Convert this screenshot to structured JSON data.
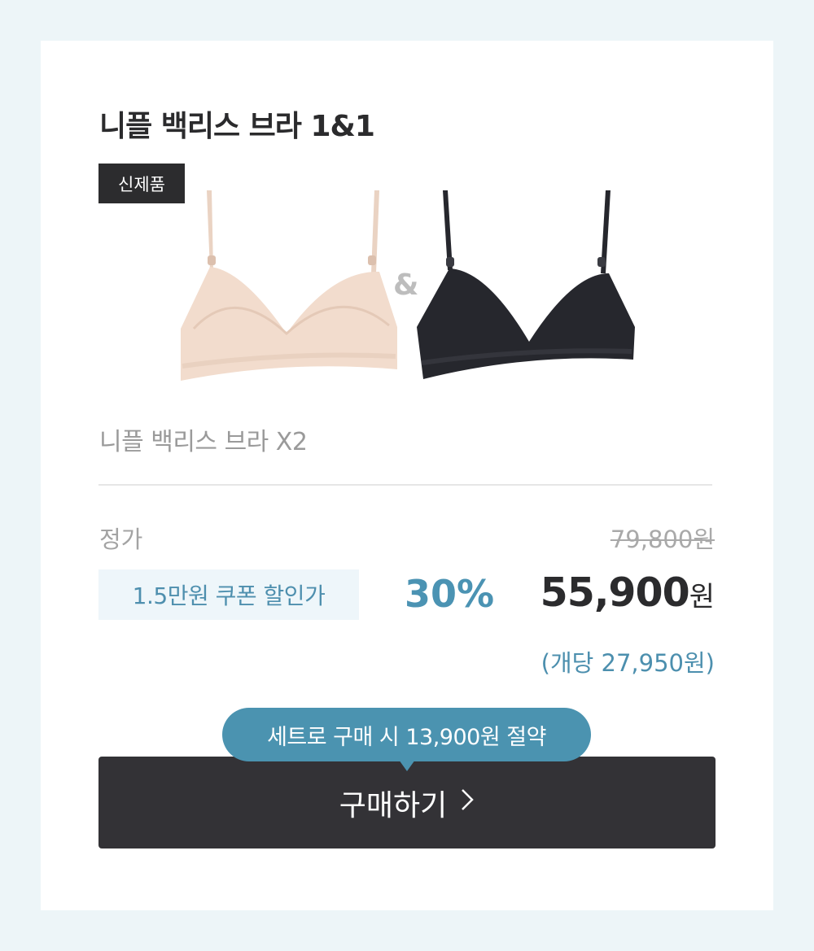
{
  "product": {
    "title": "니플 백리스 브라 1&1",
    "badge": "신제품",
    "amp": "&",
    "subtitle": "니플 백리스 브라 X2",
    "colors": {
      "beige": "#f2dccd",
      "black": "#26272d",
      "accent": "#4b93b0"
    }
  },
  "pricing": {
    "regular_label": "정가",
    "regular_price": "79,800원",
    "coupon_label": "1.5만원 쿠폰 할인가",
    "discount_rate": "30%",
    "sale_price": "55,900",
    "sale_unit": "원",
    "unit_price": "(개당 27,950원)"
  },
  "cta": {
    "tooltip": "세트로 구매 시 13,900원 절약",
    "buy_label": "구매하기",
    "chevron_icon": "chevron-right-icon"
  }
}
